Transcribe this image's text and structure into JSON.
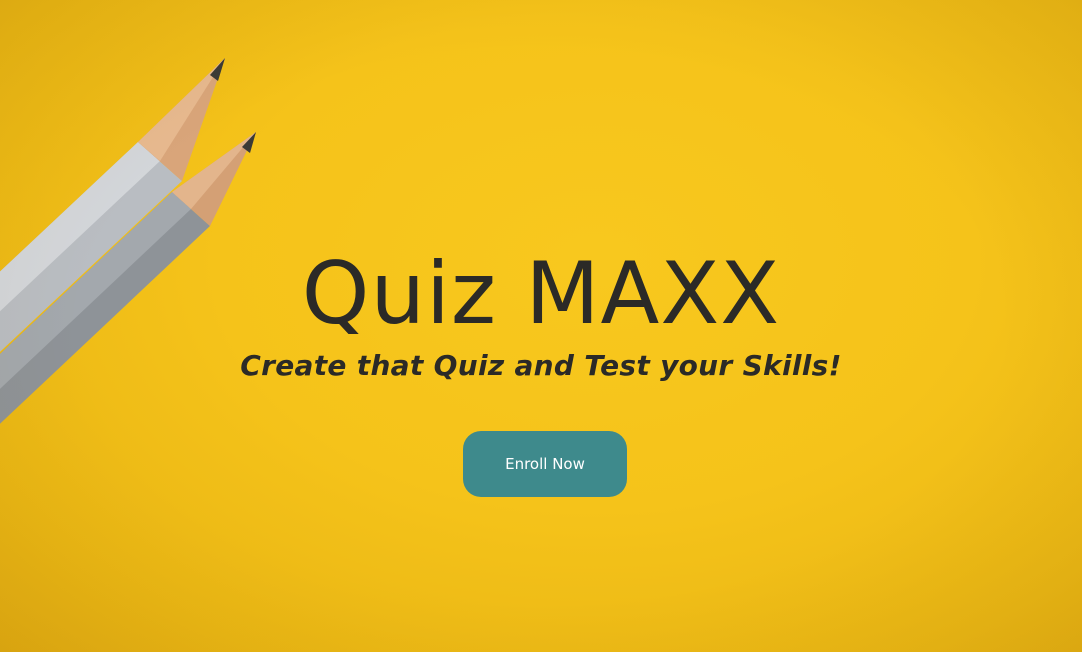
{
  "hero": {
    "title": "Quiz MAXX",
    "subtitle": "Create that Quiz and Test your Skills!",
    "enroll_label": "Enroll Now"
  },
  "colors": {
    "background": "#f5c31a",
    "text": "#2b2a27",
    "button": "#3e8a8c",
    "button_text": "#ffffff"
  },
  "icons": {
    "decoration": "pencils-image"
  }
}
